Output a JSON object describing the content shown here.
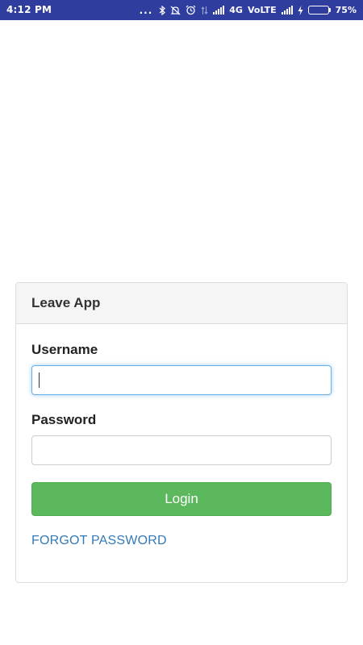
{
  "status_bar": {
    "time": "4:12 PM",
    "more_indicator": "...",
    "network_type": "4G",
    "volte": "VoLTE",
    "battery_percent": "75%",
    "battery_level": 0.75,
    "background_color": "#2f3e9e"
  },
  "panel": {
    "title": "Leave App"
  },
  "form": {
    "username_label": "Username",
    "username_value": "",
    "password_label": "Password",
    "password_value": "",
    "login_label": "Login",
    "forgot_password_label": "FORGOT PASSWORD"
  },
  "colors": {
    "login_button": "#5cb85c",
    "link": "#337ab7",
    "focus_border": "#66afe9"
  }
}
